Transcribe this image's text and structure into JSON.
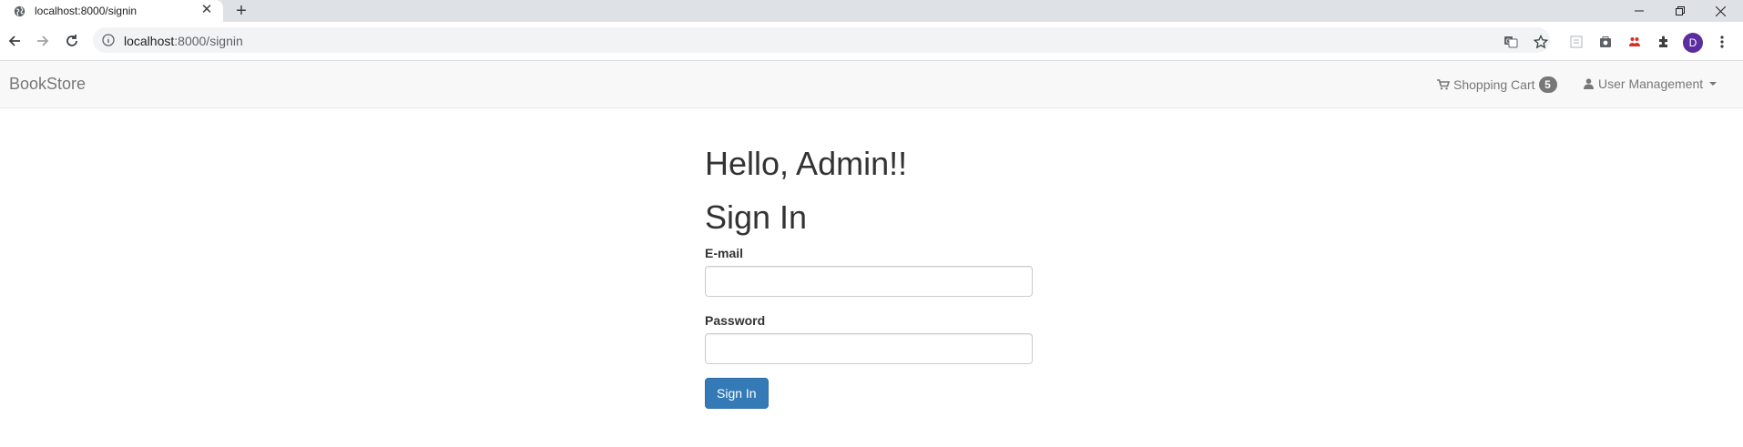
{
  "browser": {
    "tab_title": "localhost:8000/signin",
    "url_host": "localhost",
    "url_path": ":8000/signin",
    "avatar_letter": "D"
  },
  "navbar": {
    "brand": "BookStore",
    "cart_label": "Shopping Cart",
    "cart_count": "5",
    "user_menu_label": "User Management"
  },
  "main": {
    "greeting": "Hello, Admin!!",
    "title": "Sign In",
    "email_label": "E-mail",
    "email_value": "",
    "password_label": "Password",
    "password_value": "",
    "submit_label": "Sign In"
  },
  "colors": {
    "primary": "#337ab7",
    "navbar_bg": "#f8f8f8",
    "badge_bg": "#777777",
    "avatar_bg": "#5b2d9e"
  },
  "icons": [
    "globe-icon",
    "close-icon",
    "plus-icon",
    "minimize-icon",
    "restore-icon",
    "back-icon",
    "forward-icon",
    "reload-icon",
    "info-icon",
    "translate-icon",
    "star-icon",
    "extension-icon",
    "shopping-cart-icon",
    "user-icon"
  ]
}
